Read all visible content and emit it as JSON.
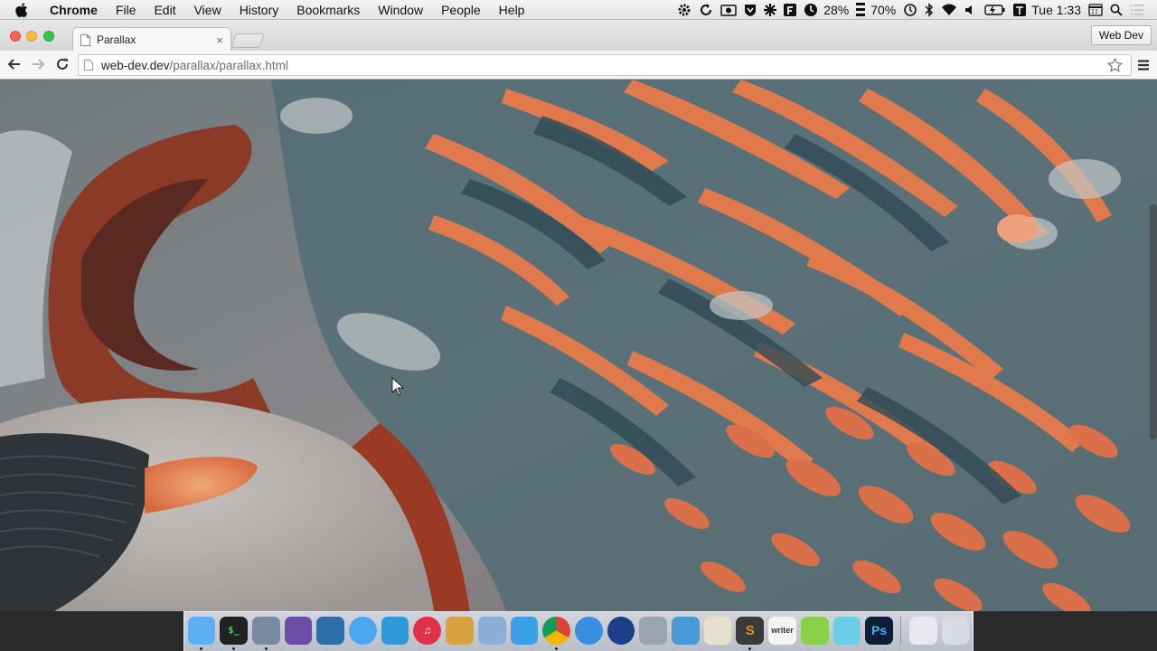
{
  "menubar": {
    "app_name": "Chrome",
    "menus": [
      "File",
      "Edit",
      "View",
      "History",
      "Bookmarks",
      "Window",
      "People",
      "Help"
    ],
    "status": {
      "cpu_percent": "28%",
      "battery_percent": "70%",
      "clock": "Tue 1:33",
      "icons": [
        "gear-icon",
        "sync-icon",
        "camera-icon",
        "shield-icon",
        "cross-icon",
        "f-icon",
        "activity-icon",
        "speed-icon",
        "time-machine-icon",
        "bluetooth-icon",
        "wifi-icon",
        "volume-icon",
        "battery-icon",
        "keyboard-icon",
        "calendar-icon",
        "spotlight-icon",
        "notifications-icon"
      ]
    }
  },
  "browser": {
    "tab_title": "Parallax",
    "profile_label": "Web Dev",
    "url_host": "web-dev.dev",
    "url_path": "/parallax/parallax.html"
  },
  "page": {
    "image_subject": "Mars sand dunes aerial photograph"
  },
  "dock": {
    "apps": [
      {
        "name": "finder",
        "label": "",
        "color": "#5ab0f2",
        "running": true
      },
      {
        "name": "terminal",
        "label": "$_",
        "color": "#222222",
        "running": true
      },
      {
        "name": "textmate",
        "label": "",
        "color": "#7a8aa0",
        "running": true
      },
      {
        "name": "cloudapp",
        "label": "",
        "color": "#6b4ea8",
        "running": false
      },
      {
        "name": "trello",
        "label": "",
        "color": "#2f6ea8",
        "running": false
      },
      {
        "name": "messages",
        "label": "",
        "color": "#4aa8f0",
        "running": false
      },
      {
        "name": "twitter",
        "label": "",
        "color": "#2e9ad8",
        "running": false
      },
      {
        "name": "itunes",
        "label": "♫",
        "color": "#e0304a",
        "running": false
      },
      {
        "name": "package",
        "label": "",
        "color": "#d9a040",
        "running": false
      },
      {
        "name": "preview",
        "label": "",
        "color": "#8ab0d8",
        "running": false
      },
      {
        "name": "app-store",
        "label": "",
        "color": "#3aa0e8",
        "running": false
      },
      {
        "name": "chrome",
        "label": "",
        "color": "#f2f2f2",
        "running": true
      },
      {
        "name": "safari",
        "label": "",
        "color": "#3a8ee0",
        "running": false
      },
      {
        "name": "firefox-nightly",
        "label": "",
        "color": "#1d3f8a",
        "running": false
      },
      {
        "name": "system-preferences-window",
        "label": "",
        "color": "#9aa4b0",
        "running": false
      },
      {
        "name": "imageoptim",
        "label": "",
        "color": "#4a9ad8",
        "running": false
      },
      {
        "name": "textedit",
        "label": "",
        "color": "#e8e0cc",
        "running": false
      },
      {
        "name": "sublime-text",
        "label": "S",
        "color": "#3a3a3a",
        "running": true
      },
      {
        "name": "writer",
        "label": "writer",
        "color": "#f4f4f4",
        "running": false
      },
      {
        "name": "colorsnapper",
        "label": "",
        "color": "#8ad048",
        "running": false
      },
      {
        "name": "sketch-pad",
        "label": "",
        "color": "#6bcde8",
        "running": false
      },
      {
        "name": "photoshop",
        "label": "Ps",
        "color": "#0d1e3a",
        "running": false
      },
      {
        "name": "separator",
        "label": "",
        "color": "",
        "running": false
      },
      {
        "name": "launchpad-folder",
        "label": "",
        "color": "#e8e8ee",
        "running": false
      },
      {
        "name": "trash",
        "label": "",
        "color": "#d8dce0",
        "running": false
      }
    ]
  }
}
